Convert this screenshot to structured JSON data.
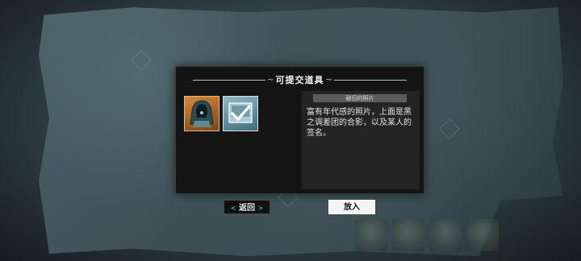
{
  "dialog": {
    "title": "可提交道具",
    "title_decor_left": "~",
    "title_decor_right": "~"
  },
  "items": [
    {
      "name": "hooded-figure-item",
      "icon": "hooded-figure-icon",
      "selected": false
    },
    {
      "name": "old-photo-item",
      "icon": "photo-check-icon",
      "selected": true
    }
  ],
  "description": {
    "item_name": "破旧的照片",
    "text": "富有年代感的照片，上面是黑之调差团的合影，以及某人的签名。"
  },
  "buttons": {
    "back_label": "返回",
    "back_decor_left": "<",
    "back_decor_right": ">",
    "put_label": "放入"
  },
  "colors": {
    "dialog_bg": "#141414",
    "slot_border": "#d7c08a",
    "put_button_bg": "#f4f4f4"
  }
}
